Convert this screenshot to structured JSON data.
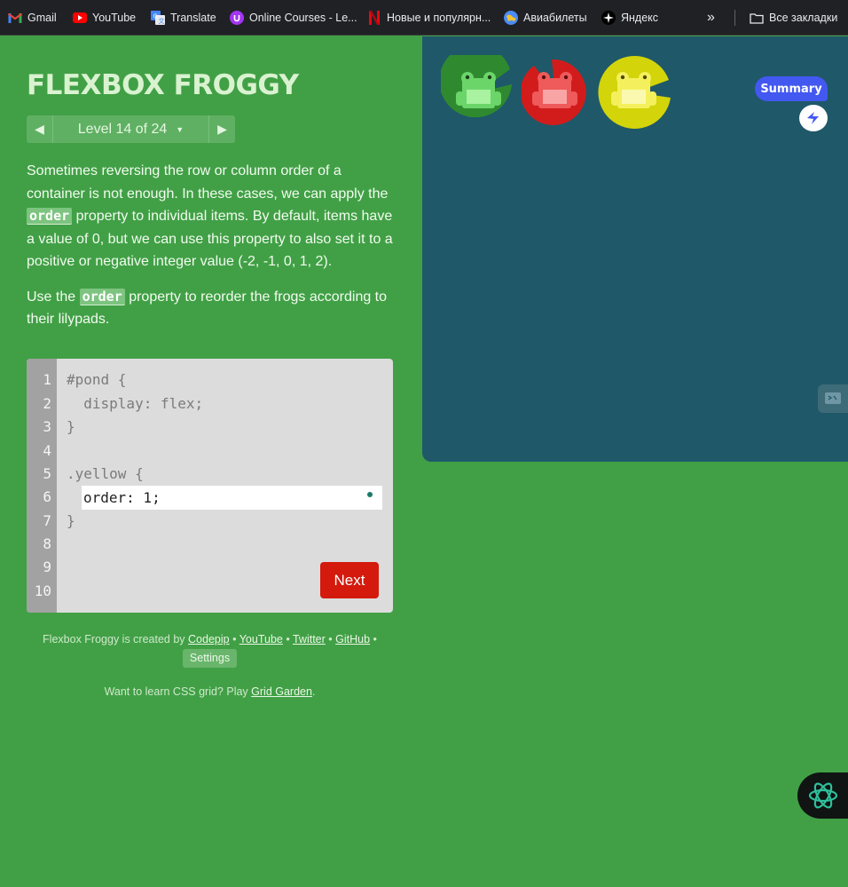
{
  "bookmarks": [
    {
      "label": "Gmail",
      "icon": "gmail-icon"
    },
    {
      "label": "YouTube",
      "icon": "youtube-icon"
    },
    {
      "label": "Translate",
      "icon": "translate-icon"
    },
    {
      "label": "Online Courses - Le...",
      "icon": "udemy-icon"
    },
    {
      "label": "Новые и популярн...",
      "icon": "netflix-icon"
    },
    {
      "label": "Авиабилеты",
      "icon": "globe-icon"
    },
    {
      "label": "Яндекс",
      "icon": "yandex-icon"
    }
  ],
  "bookmarks_overflow": "»",
  "all_bookmarks": "Все закладки",
  "game": {
    "title": "FLEXBOX FROGGY",
    "level_label": "Level 14 of 24",
    "prev_arrow": "◀",
    "next_arrow": "▶",
    "caret": "▼"
  },
  "instructions": {
    "p1_a": "Sometimes reversing the row or column order of a container is not enough. In these cases, we can apply the",
    "p1_code": "order",
    "p1_b": "property to individual items. By default, items have a value of 0, but we can use this property to also set it to a positive or negative integer value (-2, -1, 0, 1, 2).",
    "p2_a": "Use the",
    "p2_code": "order",
    "p2_b": "property to reorder the frogs according to their lilypads."
  },
  "editor": {
    "line_numbers": [
      "1",
      "2",
      "3",
      "4",
      "5",
      "6",
      "7",
      "8",
      "9",
      "10"
    ],
    "line1": "#pond {",
    "line2": "  display: flex;",
    "line3": "}",
    "line5": ".yellow {",
    "input_value": "order: 1;",
    "line7": "}",
    "next_label": "Next"
  },
  "credits": {
    "created_by": "Flexbox Froggy is created by",
    "codepip": "Codepip",
    "youtube": "YouTube",
    "twitter": "Twitter",
    "github": "GitHub",
    "bullet": "•",
    "settings": "Settings",
    "grid_prefix": "Want to learn CSS grid? Play",
    "grid_link": "Grid Garden",
    "grid_suffix": "."
  },
  "pond": {
    "lilypads": [
      {
        "color": "green",
        "hex": "#2f8a2f"
      },
      {
        "color": "red",
        "hex": "#d21c1c"
      },
      {
        "color": "yellow",
        "hex": "#d3d40a"
      }
    ],
    "frogs": [
      {
        "color": "green",
        "hex": "#6cd56a"
      },
      {
        "color": "red",
        "hex": "#ef5a5a"
      },
      {
        "color": "yellow",
        "hex": "#f4f05d"
      }
    ]
  },
  "overlay": {
    "summary_label": "Summary"
  },
  "colors": {
    "background": "#41a046",
    "pond": "#1f5869",
    "next_button": "#d4190d",
    "summary_button": "#4258f0"
  }
}
